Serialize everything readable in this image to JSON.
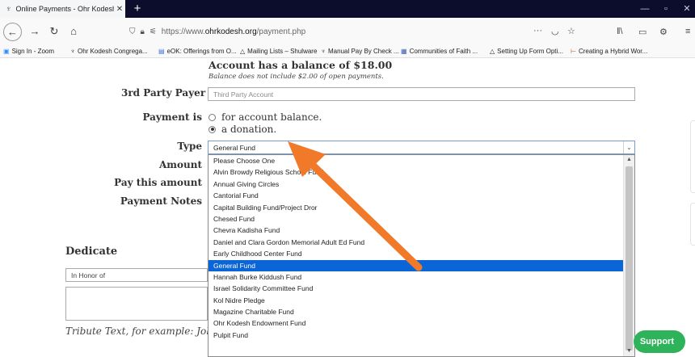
{
  "browser": {
    "tab_title": "Online Payments - Ohr Kodesh",
    "tab_close": "✕",
    "new_tab": "+",
    "window_controls": [
      "—",
      "▫",
      "✕"
    ],
    "url_scheme": "https://www.",
    "url_domain": "ohrkodesh.org",
    "url_path": "/payment.php",
    "url_menu": "···",
    "icons": {
      "back": "←",
      "forward": "→",
      "reload": "↻",
      "home": "⌂",
      "shield": "shield-icon",
      "lock": "lock-icon",
      "pocket": "pocket-icon",
      "bookmark_star": "star-icon",
      "library": "library-icon",
      "sidebar": "sidebar-icon",
      "extension": "extension-icon",
      "menu": "menu-icon"
    }
  },
  "bookmarks": [
    {
      "icon": "zoom-icon",
      "label": "Sign In - Zoom"
    },
    {
      "icon": "temple-icon",
      "label": "Ohr Kodesh Congrega..."
    },
    {
      "icon": "doc-icon",
      "label": "eOK: Offerings from O..."
    },
    {
      "icon": "drive-icon",
      "label": "Mailing Lists – Shulware"
    },
    {
      "icon": "temple-icon",
      "label": "Manual Pay By Check ..."
    },
    {
      "icon": "community-icon",
      "label": "Communities of Faith ..."
    },
    {
      "icon": "drive-icon",
      "label": "Setting Up Form Opti..."
    },
    {
      "icon": "pin-icon",
      "label": "Creating a Hybrid Wor..."
    }
  ],
  "form": {
    "balance_text": "Account has a balance of $18.00",
    "balance_note": "Balance does not include $2.00 of open payments.",
    "third_party_label": "3rd Party Payer",
    "third_party_placeholder": "Third Party Account",
    "payment_is_label": "Payment is",
    "payment_options": [
      {
        "label": "for account balance.",
        "checked": false
      },
      {
        "label": "a donation.",
        "checked": true
      }
    ],
    "type_label": "Type",
    "type_value": "General Fund",
    "amount_label": "Amount",
    "pay_this_amount_label": "Pay this amount",
    "payment_notes_label": "Payment Notes",
    "dedicate_heading": "Dedicate",
    "dedicate_value": "In Honor of",
    "tribute_label": "Tribute Text, for example: John",
    "support_button": "Support"
  },
  "dropdown": {
    "options": [
      "Please Choose One",
      "Alvin Browdy Religious School Fund",
      "Annual Giving Circles",
      "Cantorial Fund",
      "Capital Building Fund/Project Dror",
      "Chesed Fund",
      "Chevra Kadisha Fund",
      "Daniel and Clara Gordon Memorial Adult Ed Fund",
      "Early Childhood Center Fund",
      "General Fund",
      "Hannah Burke Kiddush Fund",
      "Israel Solidarity Committee Fund",
      "Kol Nidre Pledge",
      "Magazine Charitable Fund",
      "Ohr Kodesh Endowment Fund",
      "Pulpit Fund"
    ],
    "selected_index": 9
  },
  "colors": {
    "tab_strip": "#0c0c2c",
    "selected_option": "#0a66d6",
    "annotation_arrow": "#f07a2a",
    "support_button": "#2fb35a"
  }
}
